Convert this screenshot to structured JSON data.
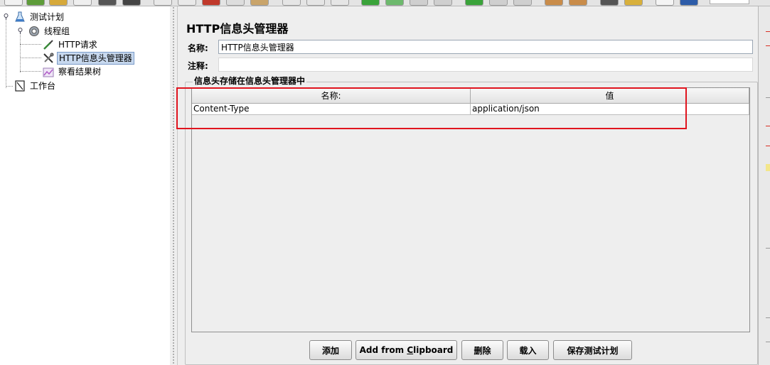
{
  "tree": {
    "items": [
      {
        "label": "测试计划",
        "icon": "flask-icon"
      },
      {
        "label": "线程组",
        "icon": "gear-icon"
      },
      {
        "label": "HTTP请求",
        "icon": "dropper-icon"
      },
      {
        "label": "HTTP信息头管理器",
        "icon": "wrench-icon"
      },
      {
        "label": "察看结果树",
        "icon": "chart-icon"
      },
      {
        "label": "工作台",
        "icon": "workbench-icon"
      }
    ]
  },
  "panel": {
    "title": "HTTP信息头管理器",
    "name_label": "名称:",
    "name_value": "HTTP信息头管理器",
    "comment_label": "注释:",
    "comment_value": "",
    "group_title": "信息头存储在信息头管理器中"
  },
  "table": {
    "columns": [
      "名称:",
      "值"
    ],
    "rows": [
      {
        "name": "Content-Type",
        "value": "application/json"
      }
    ]
  },
  "buttons": {
    "add": "添加",
    "add_from_clipboard_pre": "Add from ",
    "add_from_clipboard_u": "C",
    "add_from_clipboard_post": "lipboard",
    "delete": "删除",
    "load": "载入",
    "save": "保存测试计划"
  },
  "colors": {
    "selection": "#c7d8ee",
    "highlight": "#e0141e",
    "accent_red": "#d93025"
  }
}
